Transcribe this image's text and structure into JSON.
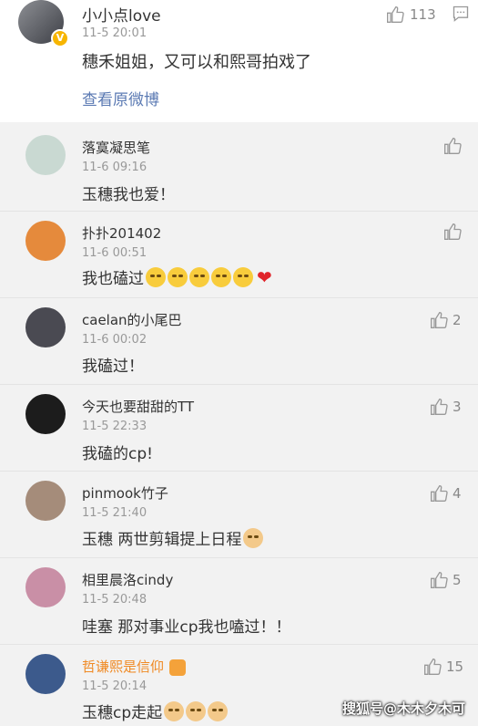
{
  "post": {
    "username": "小小点love",
    "time": "11-5 20:01",
    "text": "穗禾姐姐，又可以和熙哥拍戏了",
    "view_original": "查看原微博",
    "likes": "113",
    "vip_badge": "V"
  },
  "comments": [
    {
      "name": "落寞凝思笔",
      "time": "11-6 09:16",
      "text": "玉穗我也爱！",
      "likes": "",
      "avatar_color": "#c9d9d2"
    },
    {
      "name": "扑扑201402",
      "time": "11-6 00:51",
      "text": "我也磕过",
      "likes": "",
      "avatar_color": "#e58a3c"
    },
    {
      "name": "caelan的小尾巴",
      "time": "11-6 00:02",
      "text": "我磕过！",
      "likes": "2",
      "avatar_color": "#4a4a52"
    },
    {
      "name": "今天也要甜甜的TT",
      "time": "11-5 22:33",
      "text": "我磕的cp!",
      "likes": "3",
      "avatar_color": "#1c1c1c"
    },
    {
      "name": "pinmook竹子",
      "time": "11-5 21:40",
      "text": "玉穗 两世剪辑提上日程",
      "likes": "4",
      "avatar_color": "#a58c7a"
    },
    {
      "name": "相里晨洛cindy",
      "time": "11-5 20:48",
      "text": "哇塞 那对事业cp我也嗑过！！",
      "likes": "5",
      "avatar_color": "#c98fa6"
    },
    {
      "name": "哲谦熙是信仰",
      "time": "11-5 20:14",
      "text": "玉穗cp走起",
      "likes": "15",
      "avatar_color": "#3c5a8c",
      "name_color": "#f08a24"
    }
  ],
  "watermark": "搜狐号@木木夕木可"
}
